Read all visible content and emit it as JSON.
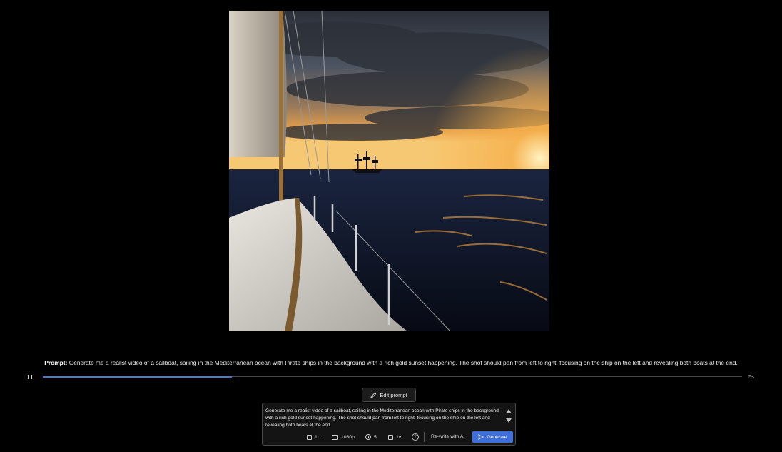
{
  "video": {
    "scene": "sailboat-sunset"
  },
  "prompt_line": {
    "label": "Prompt:",
    "text": "Generate me a realist video of a sailboat, sailing in the Mediterranean ocean with Pirate ships in the background with a rich gold sunset happening. The shot should pan from left to right, focusing on the ship on the left and revealing both boats at the end."
  },
  "timeline": {
    "progress": 0.27,
    "duration": "5s",
    "state": "playing"
  },
  "edit_prompt": {
    "label": "Edit prompt"
  },
  "prompt_box": {
    "value": "Generate me a realist video of a sailboat, sailing in the Mediterranean ocean with Pirate ships in the background with a rich gold sunset happening. The shot should pan from left to right, focusing on the ship on the left and revealing both boats at the end.",
    "aspect_ratio": "1:1",
    "resolution": "1080p",
    "duration": "5",
    "variants": "1v",
    "rewrite_label": "Re-write with AI",
    "generate_label": "Generate"
  },
  "colors": {
    "accent": "#3f6fd8",
    "progress": "#4a78d8",
    "background": "#000000"
  }
}
